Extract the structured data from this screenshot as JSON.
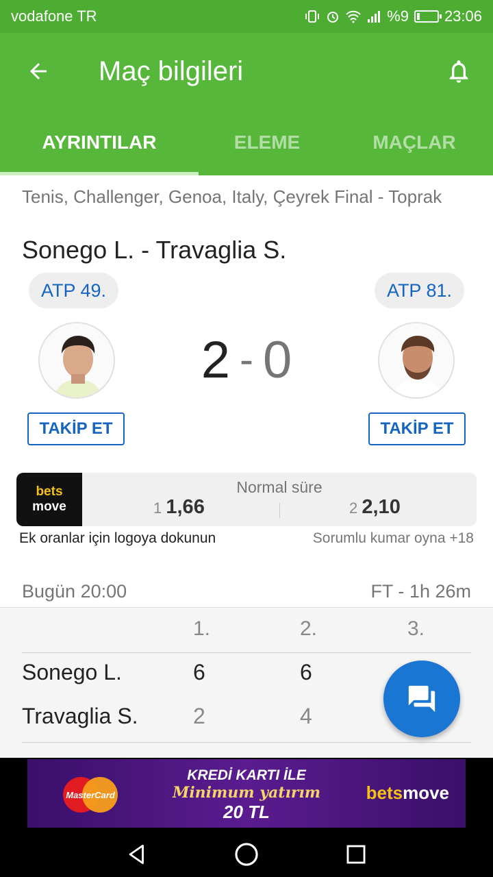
{
  "status_bar": {
    "carrier": "vodafone TR",
    "battery": "%9",
    "time": "23:06"
  },
  "app_bar": {
    "title": "Maç bilgileri"
  },
  "tabs": [
    {
      "label": "AYRINTILAR",
      "active": true
    },
    {
      "label": "ELEME",
      "active": false
    },
    {
      "label": "MAÇLAR",
      "active": false
    }
  ],
  "match": {
    "category": "Tenis, Challenger, Genoa, Italy, Çeyrek Final - Toprak",
    "title": "Sonego L. - Travaglia S.",
    "home": {
      "rank": "ATP 49.",
      "follow_label": "TAKİP ET"
    },
    "away": {
      "rank": "ATP 81.",
      "follow_label": "TAKİP ET"
    },
    "score_home": "2",
    "score_sep": "-",
    "score_away": "0"
  },
  "odds": {
    "logo_top": "bets",
    "logo_bottom": "move",
    "period": "Normal süre",
    "home_label": "1",
    "home_value": "1,66",
    "away_label": "2",
    "away_value": "2,10",
    "hint": "Ek oranlar için logoya dokunun",
    "responsible": "Sorumlu kumar oyna +18"
  },
  "time_row": {
    "start": "Bugün 20:00",
    "status": "FT - 1h 26m"
  },
  "score_table": {
    "headers": [
      "1.",
      "2.",
      "3."
    ],
    "rows": [
      {
        "name": "Sonego L.",
        "sets": [
          "6",
          "6"
        ]
      },
      {
        "name": "Travaglia S.",
        "sets": [
          "2",
          "4"
        ]
      }
    ]
  },
  "ad": {
    "card": "MasterCard",
    "line1": "KREDİ KARTI İLE",
    "line2": "Minimum yatırım",
    "line3": "20 TL",
    "brand_a": "bets",
    "brand_b": "move"
  },
  "colors": {
    "appbar": "#56b73a",
    "statusbar": "#4dad32",
    "accent_blue": "#1565c0",
    "fab": "#1976d2"
  }
}
